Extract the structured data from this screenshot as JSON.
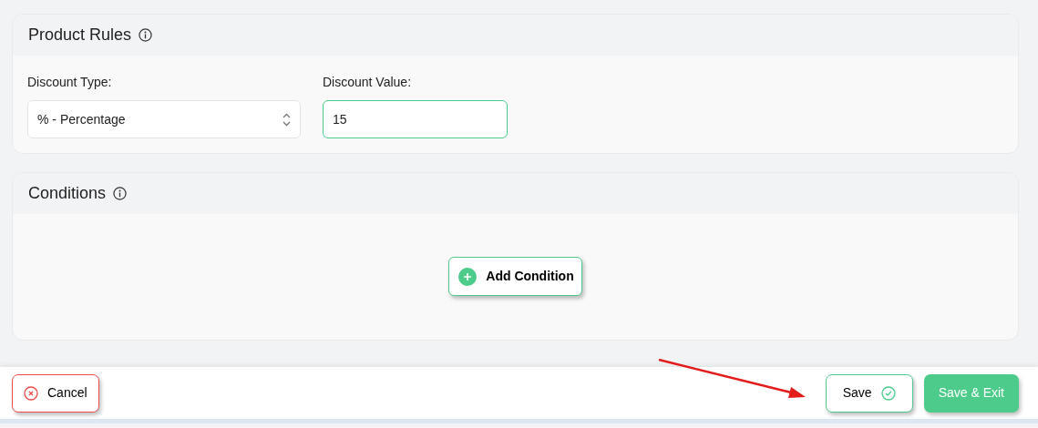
{
  "product_rules": {
    "title": "Product Rules",
    "discount_type": {
      "label": "Discount Type:",
      "value": "% - Percentage"
    },
    "discount_value": {
      "label": "Discount Value:",
      "value": "15"
    }
  },
  "conditions": {
    "title": "Conditions",
    "add_button": "Add Condition"
  },
  "footer": {
    "cancel": "Cancel",
    "save": "Save",
    "save_exit": "Save & Exit"
  }
}
